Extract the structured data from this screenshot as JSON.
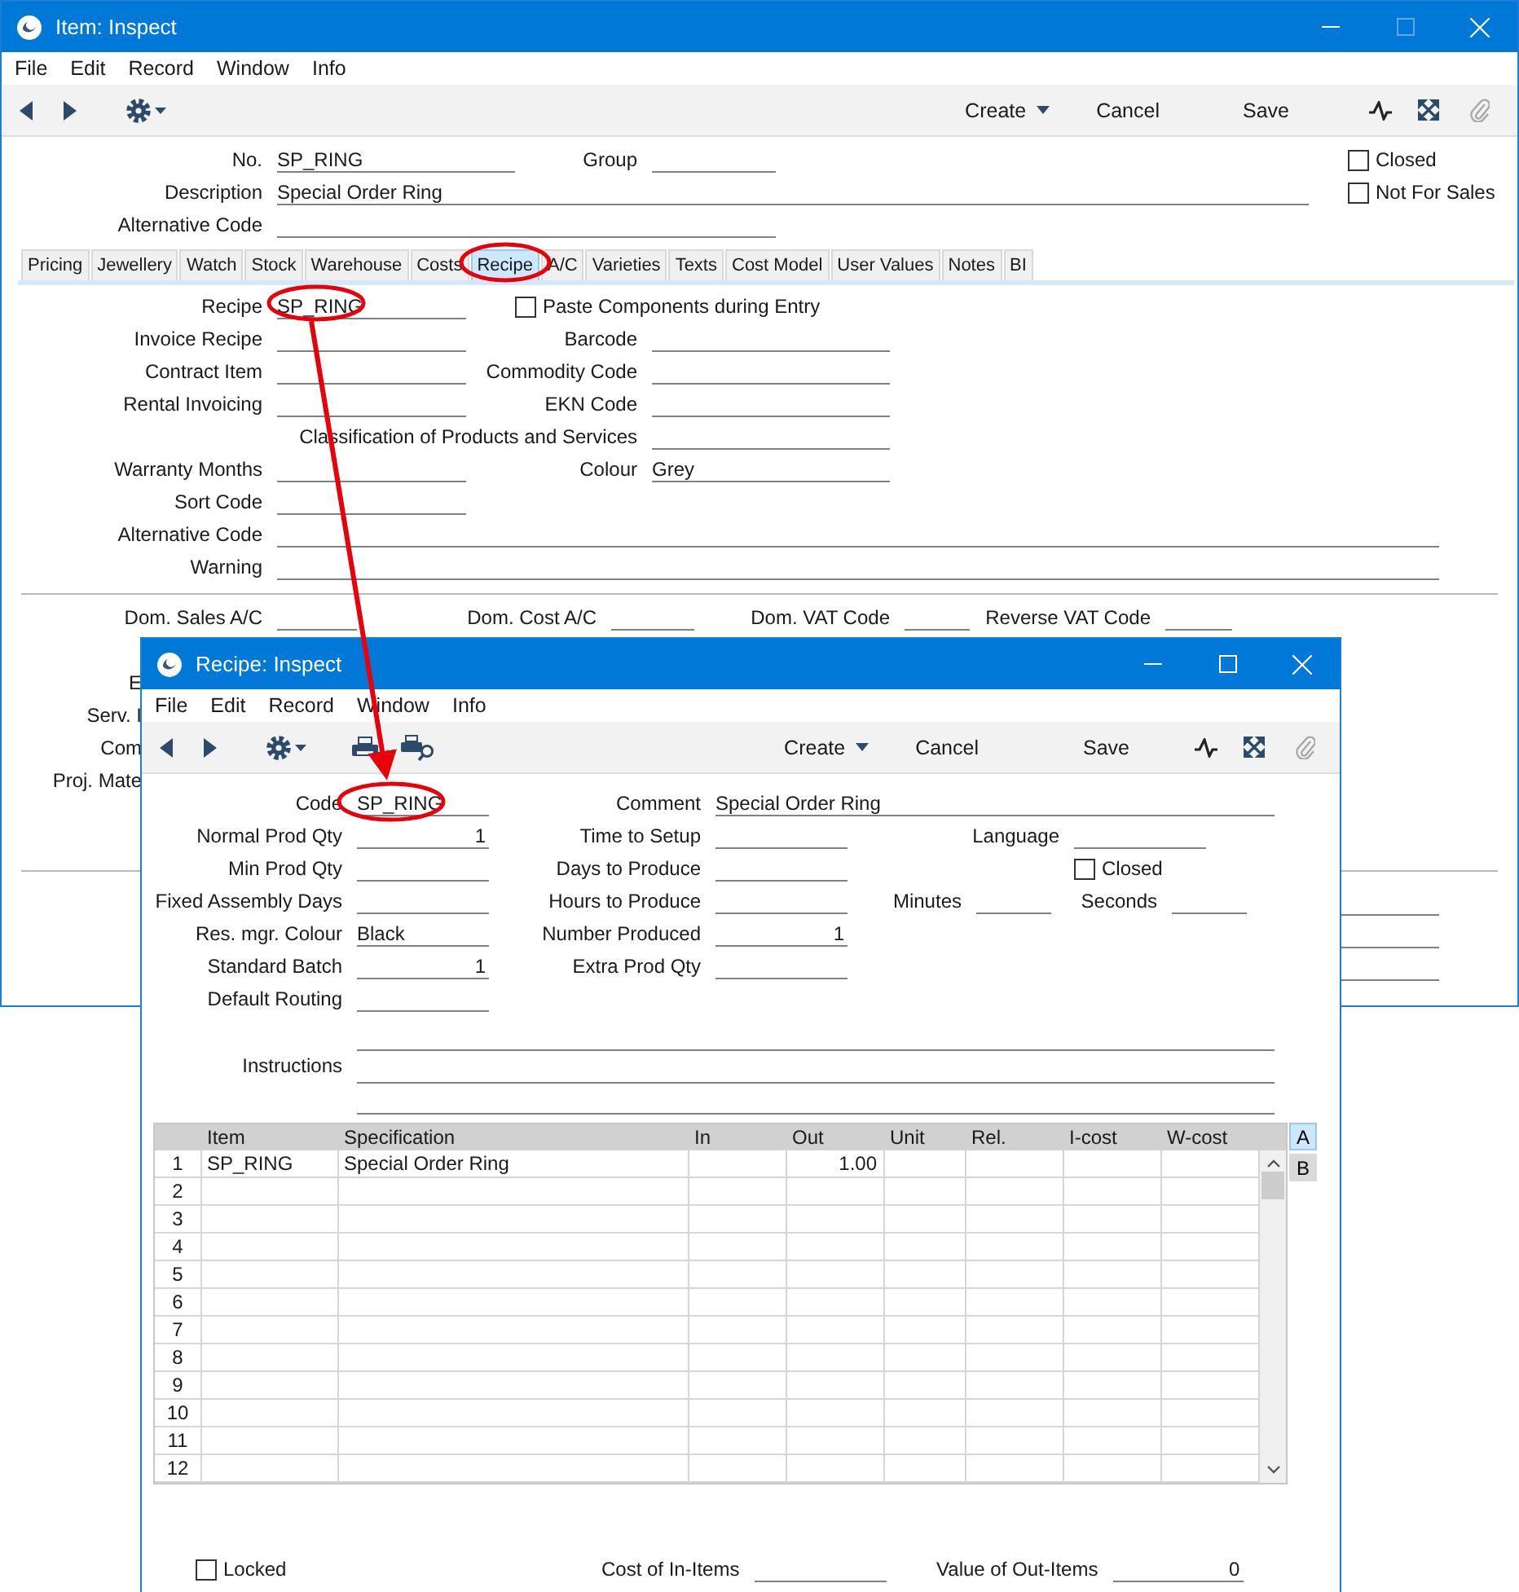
{
  "item_window": {
    "title": "Item: Inspect",
    "maximize_disabled": true,
    "menu": [
      "File",
      "Edit",
      "Record",
      "Window",
      "Info"
    ],
    "toolbar": {
      "create": "Create",
      "cancel": "Cancel",
      "save": "Save",
      "attach_disabled": true
    },
    "header_rows": [
      [
        {
          "kind": "field",
          "label": "No.",
          "value": "SP_RING"
        },
        {
          "kind": "field",
          "label": "Group"
        },
        {
          "kind": "checkbox",
          "label": "Closed",
          "checked": false
        }
      ],
      [
        {
          "kind": "field",
          "label": "Description",
          "value": "Special Order Ring"
        },
        {
          "kind": "checkbox",
          "label": "Not For Sales",
          "checked": false
        }
      ],
      [
        {
          "kind": "field",
          "label": "Alternative Code"
        }
      ]
    ],
    "tabs": [
      {
        "label": "Pricing",
        "selected": false
      },
      {
        "label": "Jewellery",
        "selected": false
      },
      {
        "label": "Watch",
        "selected": false
      },
      {
        "label": "Stock",
        "selected": false
      },
      {
        "label": "Warehouse",
        "selected": false
      },
      {
        "label": "Costs",
        "selected": false
      },
      {
        "label": "Recipe",
        "selected": true
      },
      {
        "label": "A/C",
        "selected": false
      },
      {
        "label": "Varieties",
        "selected": false
      },
      {
        "label": "Texts",
        "selected": false
      },
      {
        "label": "Cost Model",
        "selected": false
      },
      {
        "label": "User Values",
        "selected": false
      },
      {
        "label": "Notes",
        "selected": false
      },
      {
        "label": "BI",
        "selected": false
      }
    ],
    "recipe_rows": [
      [
        {
          "kind": "field",
          "label": "Recipe",
          "value": "SP_RING"
        },
        {
          "kind": "checkbox",
          "label": "Paste Components during Entry",
          "checked": false
        }
      ],
      [
        {
          "kind": "field",
          "label": "Invoice Recipe"
        },
        {
          "kind": "field",
          "label": "Barcode"
        }
      ],
      [
        {
          "kind": "field",
          "label": "Contract Item"
        },
        {
          "kind": "field",
          "label": "Commodity Code"
        }
      ],
      [
        {
          "kind": "field",
          "label": "Rental Invoicing"
        },
        {
          "kind": "field",
          "label": "EKN Code"
        }
      ],
      [
        {
          "kind": "field",
          "label": "Classification of Products and Services"
        }
      ],
      [
        {
          "kind": "field",
          "label": "Warranty Months"
        },
        {
          "kind": "field",
          "label": "Colour",
          "value": "Grey"
        }
      ],
      [
        {
          "kind": "field",
          "label": "Sort Code"
        }
      ],
      [
        {
          "kind": "field",
          "label": "Alternative Code"
        }
      ],
      [
        {
          "kind": "field",
          "label": "Warning"
        }
      ]
    ],
    "account_rows": [
      [
        {
          "kind": "field",
          "label": "Dom. Sales A/C"
        },
        {
          "kind": "field",
          "label": "Dom. Cost A/C"
        },
        {
          "kind": "field",
          "label": "Dom. VAT Code"
        },
        {
          "kind": "field",
          "label": "Reverse VAT Code"
        }
      ]
    ],
    "covered_labels": [
      "E",
      "Serv. I",
      "Com",
      "Proj. Mate"
    ]
  },
  "recipe_window": {
    "title": "Recipe: Inspect",
    "maximize_disabled": false,
    "menu": [
      "File",
      "Edit",
      "Record",
      "Window",
      "Info"
    ],
    "toolbar": {
      "create": "Create",
      "cancel": "Cancel",
      "save": "Save",
      "attach_disabled": true
    },
    "rows": [
      [
        {
          "kind": "field",
          "label": "Code",
          "value": "SP_RING"
        },
        {
          "kind": "field",
          "label": "Comment",
          "value": "Special Order Ring"
        }
      ],
      [
        {
          "kind": "field",
          "label": "Normal Prod Qty",
          "value": "1"
        },
        {
          "kind": "field",
          "label": "Time to Setup"
        },
        {
          "kind": "field",
          "label": "Language"
        }
      ],
      [
        {
          "kind": "field",
          "label": "Min Prod Qty"
        },
        {
          "kind": "field",
          "label": "Days to Produce"
        },
        {
          "kind": "empty"
        },
        {
          "kind": "checkbox",
          "label": "Closed",
          "checked": false
        }
      ],
      [
        {
          "kind": "field",
          "label": "Fixed Assembly Days"
        },
        {
          "kind": "field",
          "label": "Hours to Produce"
        },
        {
          "kind": "field",
          "label": "Minutes"
        },
        {
          "kind": "field",
          "label": "Seconds"
        }
      ],
      [
        {
          "kind": "field",
          "label": "Res. mgr. Colour",
          "value": "Black"
        },
        {
          "kind": "field",
          "label": "Number Produced",
          "value": "1"
        }
      ],
      [
        {
          "kind": "field",
          "label": "Standard Batch",
          "value": "1"
        },
        {
          "kind": "field",
          "label": "Extra Prod Qty"
        }
      ],
      [
        {
          "kind": "field",
          "label": "Default Routing"
        }
      ],
      [
        {
          "kind": "field",
          "label": "Instructions"
        }
      ]
    ],
    "table": {
      "columns": [
        "Item",
        "Specification",
        "In",
        "Out",
        "Unit",
        "Rel.",
        "I-cost",
        "W-cost"
      ],
      "rows": [
        {
          "number": "1",
          "item": "SP_RING",
          "specification": "Special Order Ring",
          "out": "1.00"
        },
        {
          "number": "2"
        },
        {
          "number": "3"
        },
        {
          "number": "4"
        },
        {
          "number": "5"
        },
        {
          "number": "6"
        },
        {
          "number": "7"
        },
        {
          "number": "8"
        },
        {
          "number": "9"
        },
        {
          "number": "10"
        },
        {
          "number": "11"
        },
        {
          "number": "12"
        }
      ]
    },
    "side_tabs": [
      {
        "label": "A",
        "selected": true
      },
      {
        "label": "B",
        "selected": false
      }
    ],
    "footer": [
      {
        "kind": "checkbox",
        "label": "Locked",
        "checked": false
      },
      {
        "kind": "field",
        "label": "Cost of In-Items"
      },
      {
        "kind": "field",
        "label": "Value of Out-Items",
        "value": "0"
      }
    ]
  }
}
